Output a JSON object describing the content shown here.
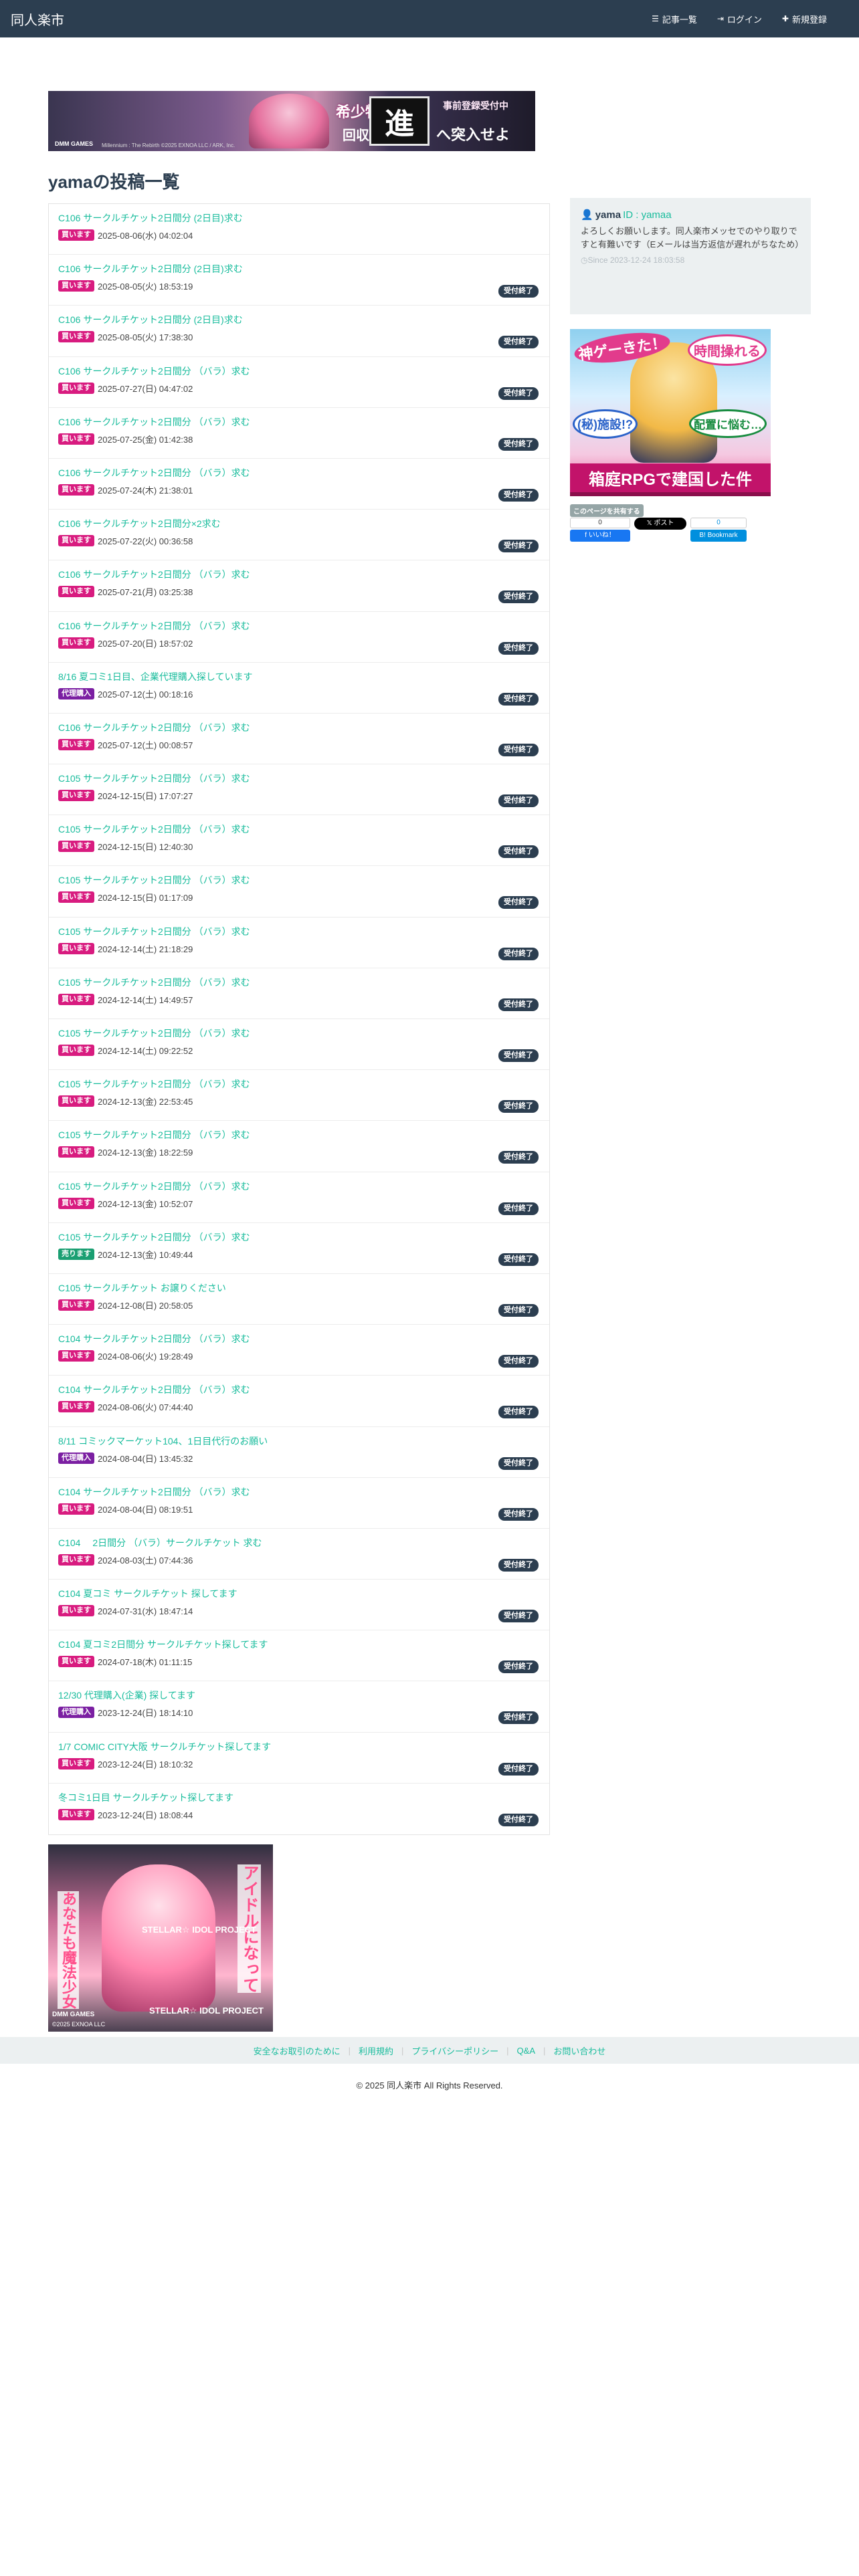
{
  "nav": {
    "brand": "同人楽市",
    "links": [
      {
        "icon": "list-icon",
        "label": "記事一覧"
      },
      {
        "icon": "login-icon",
        "label": "ログイン"
      },
      {
        "icon": "plus-icon",
        "label": "新規登録"
      }
    ]
  },
  "top_banner": {
    "logo": "DMM GAMES",
    "line1": "希少物質",
    "line2": "回収せよ",
    "big": "進",
    "tag": "事前登録受付中",
    "line3": "へ突入せよ",
    "copyright": "Millennium : The Rebirth ©2025 EXNOA LLC / ARK, Inc."
  },
  "page_title": "yamaの投稿一覧",
  "done_label": "受付終了",
  "badge_colors": {
    "buy": "#d81b7f",
    "sell": "#1a9f72",
    "proxy": "#7b1fa2"
  },
  "posts": [
    {
      "title": "C106 サークルチケット2日間分 (2日目)求む",
      "badge": "買います",
      "type": "buy",
      "date": "2025-08-06(水) 04:02:04",
      "done": false
    },
    {
      "title": "C106 サークルチケット2日間分 (2日目)求む",
      "badge": "買います",
      "type": "buy",
      "date": "2025-08-05(火) 18:53:19",
      "done": true
    },
    {
      "title": "C106 サークルチケット2日間分 (2日目)求む",
      "badge": "買います",
      "type": "buy",
      "date": "2025-08-05(火) 17:38:30",
      "done": true
    },
    {
      "title": "C106 サークルチケット2日間分 （バラ）求む",
      "badge": "買います",
      "type": "buy",
      "date": "2025-07-27(日) 04:47:02",
      "done": true
    },
    {
      "title": "C106 サークルチケット2日間分 （バラ）求む",
      "badge": "買います",
      "type": "buy",
      "date": "2025-07-25(金) 01:42:38",
      "done": true
    },
    {
      "title": "C106 サークルチケット2日間分 （バラ）求む",
      "badge": "買います",
      "type": "buy",
      "date": "2025-07-24(木) 21:38:01",
      "done": true
    },
    {
      "title": "C106 サークルチケット2日間分×2求む",
      "badge": "買います",
      "type": "buy",
      "date": "2025-07-22(火) 00:36:58",
      "done": true
    },
    {
      "title": "C106 サークルチケット2日間分 （バラ）求む",
      "badge": "買います",
      "type": "buy",
      "date": "2025-07-21(月) 03:25:38",
      "done": true
    },
    {
      "title": "C106 サークルチケット2日間分 （バラ）求む",
      "badge": "買います",
      "type": "buy",
      "date": "2025-07-20(日) 18:57:02",
      "done": true
    },
    {
      "title": "8/16 夏コミ1日目、企業代理購入探しています",
      "badge": "代理購入",
      "type": "proxy",
      "date": "2025-07-12(土) 00:18:16",
      "done": true
    },
    {
      "title": "C106 サークルチケット2日間分 （バラ）求む",
      "badge": "買います",
      "type": "buy",
      "date": "2025-07-12(土) 00:08:57",
      "done": true
    },
    {
      "title": "C105 サークルチケット2日間分 （バラ）求む",
      "badge": "買います",
      "type": "buy",
      "date": "2024-12-15(日) 17:07:27",
      "done": true
    },
    {
      "title": "C105 サークルチケット2日間分 （バラ）求む",
      "badge": "買います",
      "type": "buy",
      "date": "2024-12-15(日) 12:40:30",
      "done": true
    },
    {
      "title": "C105 サークルチケット2日間分 （バラ）求む",
      "badge": "買います",
      "type": "buy",
      "date": "2024-12-15(日) 01:17:09",
      "done": true
    },
    {
      "title": "C105 サークルチケット2日間分 （バラ）求む",
      "badge": "買います",
      "type": "buy",
      "date": "2024-12-14(土) 21:18:29",
      "done": true
    },
    {
      "title": "C105 サークルチケット2日間分 （バラ）求む",
      "badge": "買います",
      "type": "buy",
      "date": "2024-12-14(土) 14:49:57",
      "done": true
    },
    {
      "title": "C105 サークルチケット2日間分 （バラ）求む",
      "badge": "買います",
      "type": "buy",
      "date": "2024-12-14(土) 09:22:52",
      "done": true
    },
    {
      "title": "C105 サークルチケット2日間分 （バラ）求む",
      "badge": "買います",
      "type": "buy",
      "date": "2024-12-13(金) 22:53:45",
      "done": true
    },
    {
      "title": "C105 サークルチケット2日間分 （バラ）求む",
      "badge": "買います",
      "type": "buy",
      "date": "2024-12-13(金) 18:22:59",
      "done": true
    },
    {
      "title": "C105 サークルチケット2日間分 （バラ）求む",
      "badge": "買います",
      "type": "buy",
      "date": "2024-12-13(金) 10:52:07",
      "done": true
    },
    {
      "title": "C105 サークルチケット2日間分 （バラ）求む",
      "badge": "売ります",
      "type": "sell",
      "date": "2024-12-13(金) 10:49:44",
      "done": true
    },
    {
      "title": "C105 サークルチケット お譲りください",
      "badge": "買います",
      "type": "buy",
      "date": "2024-12-08(日) 20:58:05",
      "done": true
    },
    {
      "title": "C104 サークルチケット2日間分 （バラ）求む",
      "badge": "買います",
      "type": "buy",
      "date": "2024-08-06(火) 19:28:49",
      "done": true
    },
    {
      "title": "C104 サークルチケット2日間分 （バラ）求む",
      "badge": "買います",
      "type": "buy",
      "date": "2024-08-06(火) 07:44:40",
      "done": true
    },
    {
      "title": "8/11 コミックマーケット104、1日目代行のお願い",
      "badge": "代理購入",
      "type": "proxy",
      "date": "2024-08-04(日) 13:45:32",
      "done": true
    },
    {
      "title": "C104 サークルチケット2日間分 （バラ）求む",
      "badge": "買います",
      "type": "buy",
      "date": "2024-08-04(日) 08:19:51",
      "done": true
    },
    {
      "title": "C104 　2日間分 （バラ）サークルチケット 求む",
      "badge": "買います",
      "type": "buy",
      "date": "2024-08-03(土) 07:44:36",
      "done": true
    },
    {
      "title": "C104 夏コミ サークルチケット 探してます",
      "badge": "買います",
      "type": "buy",
      "date": "2024-07-31(水) 18:47:14",
      "done": true
    },
    {
      "title": "C104 夏コミ2日間分 サークルチケット探してます",
      "badge": "買います",
      "type": "buy",
      "date": "2024-07-18(木) 01:11:15",
      "done": true
    },
    {
      "title": "12/30 代理購入(企業) 探してます",
      "badge": "代理購入",
      "type": "proxy",
      "date": "2023-12-24(日) 18:14:10",
      "done": true
    },
    {
      "title": "1/7 COMIC CITY大阪 サークルチケット探してます",
      "badge": "買います",
      "type": "buy",
      "date": "2023-12-24(日) 18:10:32",
      "done": true
    },
    {
      "title": "冬コミ1日目 サークルチケット探してます",
      "badge": "買います",
      "type": "buy",
      "date": "2023-12-24(日) 18:08:44",
      "done": true
    }
  ],
  "sidebar": {
    "name": "yama",
    "id": "ID : yamaa",
    "desc": "よろしくお願いします。同人楽市メッセでのやり取りですと有難いです（Eメールは当方返信が遅れがちなため）",
    "since": "Since 2023-12-24 18:03:58"
  },
  "side_banner": {
    "t1": "神ゲーきた！",
    "t2": "時間操れる",
    "t3": "(秘)施設!?",
    "t4": "配置に悩む…",
    "t5": "箱庭RPGで建国した件"
  },
  "share": {
    "label": "このページを共有する",
    "fb_count": "0",
    "fb_label": "いいね！",
    "x_label": "ポスト",
    "hatena_count": "0",
    "hatena_label": "Bookmark"
  },
  "bottom_banner": {
    "t1": "アイドルになって",
    "t2": "あなたも魔法少女",
    "t3": "STELLAR☆ IDOL PROJECT",
    "t4": "STELLAR☆ IDOL PROJECT",
    "t5": "DMM GAMES",
    "t6": "©2025 EXNOA LLC"
  },
  "footer": {
    "links": [
      "安全なお取引のために",
      "利用規約",
      "プライバシーポリシー",
      "Q&A",
      "お問い合わせ"
    ],
    "copyright": "© 2025 同人楽市 All Rights Reserved."
  }
}
